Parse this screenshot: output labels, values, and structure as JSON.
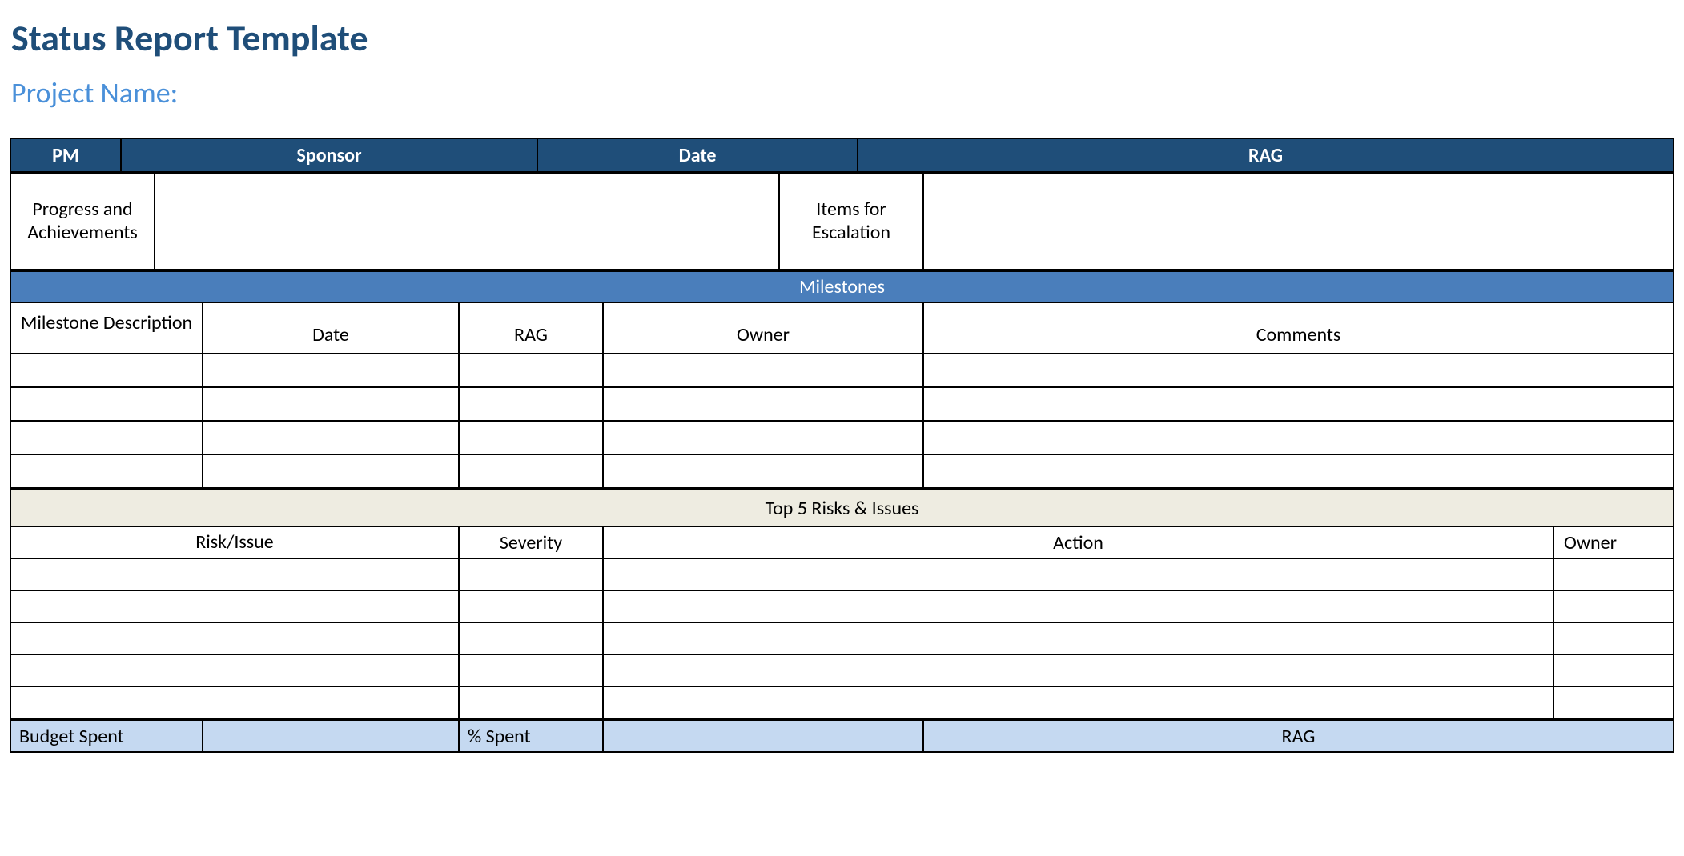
{
  "title": "Status Report Template",
  "subtitle": "Project Name:",
  "topHeader": {
    "pm": "PM",
    "sponsor": "Sponsor",
    "date": "Date",
    "rag": "RAG"
  },
  "labels": {
    "progress": "Progress and Achievements",
    "escalation": "Items for Escalation"
  },
  "milestones": {
    "band": "Milestones",
    "cols": {
      "desc": "Milestone Description",
      "date": "Date",
      "rag": "RAG",
      "owner": "Owner",
      "comments": "Comments"
    }
  },
  "risks": {
    "band": "Top 5 Risks & Issues",
    "cols": {
      "risk": "Risk/Issue",
      "severity": "Severity",
      "action": "Action",
      "owner": "Owner"
    }
  },
  "budget": {
    "spent": "Budget Spent",
    "pct": "% Spent",
    "rag": "RAG"
  }
}
